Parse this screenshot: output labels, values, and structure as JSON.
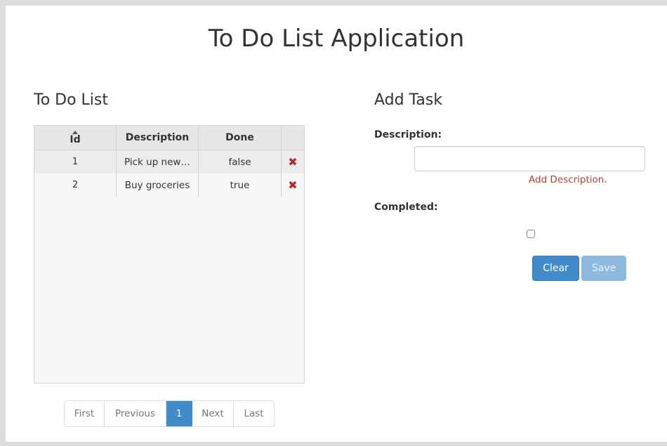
{
  "app": {
    "title": "To Do List Application"
  },
  "list": {
    "title": "To Do List",
    "columns": {
      "id": "Id",
      "description": "Description",
      "done": "Done"
    },
    "rows": [
      {
        "id": "1",
        "description": "Pick up new…",
        "done": "false"
      },
      {
        "id": "2",
        "description": "Buy groceries",
        "done": "true"
      }
    ],
    "delete_icon": "✖"
  },
  "pagination": {
    "first": "First",
    "previous": "Previous",
    "current": "1",
    "next": "Next",
    "last": "Last"
  },
  "form": {
    "title": "Add Task",
    "description_label": "Description:",
    "description_value": "",
    "description_error": "Add Description.",
    "completed_label": "Completed:",
    "completed_checked": false,
    "clear_label": "Clear",
    "save_label": "Save"
  },
  "colors": {
    "primary": "#428bca",
    "primary_disabled": "#8fb8de",
    "error": "#a94442",
    "delete": "#b22b2b"
  }
}
